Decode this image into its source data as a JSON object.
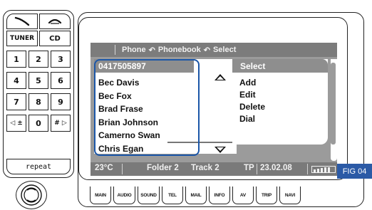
{
  "keypad": {
    "tuner_label": "TUNER",
    "cd_label": "CD",
    "keys": [
      "1",
      "2",
      "3",
      "4",
      "5",
      "6",
      "7",
      "8",
      "9",
      "0"
    ],
    "prev_label": "◁ ±",
    "next_label": "# ▷",
    "repeat_label": "repeat"
  },
  "screen": {
    "breadcrumb": [
      "Phone",
      "Phonebook",
      "Select"
    ],
    "list_header": "0417505897",
    "contacts": [
      "Bec Davis",
      "Bec Fox",
      "Brad Frase",
      "Brian Johnson",
      "Camerno Swan",
      "Chris Egan"
    ],
    "selected_contact": "Camerno Swan",
    "select_header": "Select",
    "select_options": [
      "Add",
      "Edit",
      "Delete",
      "Dial"
    ],
    "status": {
      "temperature": "23°C",
      "source": "Folder 2",
      "track": "Track 2",
      "tp": "TP",
      "date": "23.02.08"
    }
  },
  "highlight_color": "#1b56a8",
  "fig_label": "FIG 04",
  "bottom_buttons": [
    "MAIN",
    "AUDIO",
    "SOUND",
    "TEL",
    "MAIL",
    "INFO",
    "AV",
    "TRIP",
    "NAVI"
  ]
}
